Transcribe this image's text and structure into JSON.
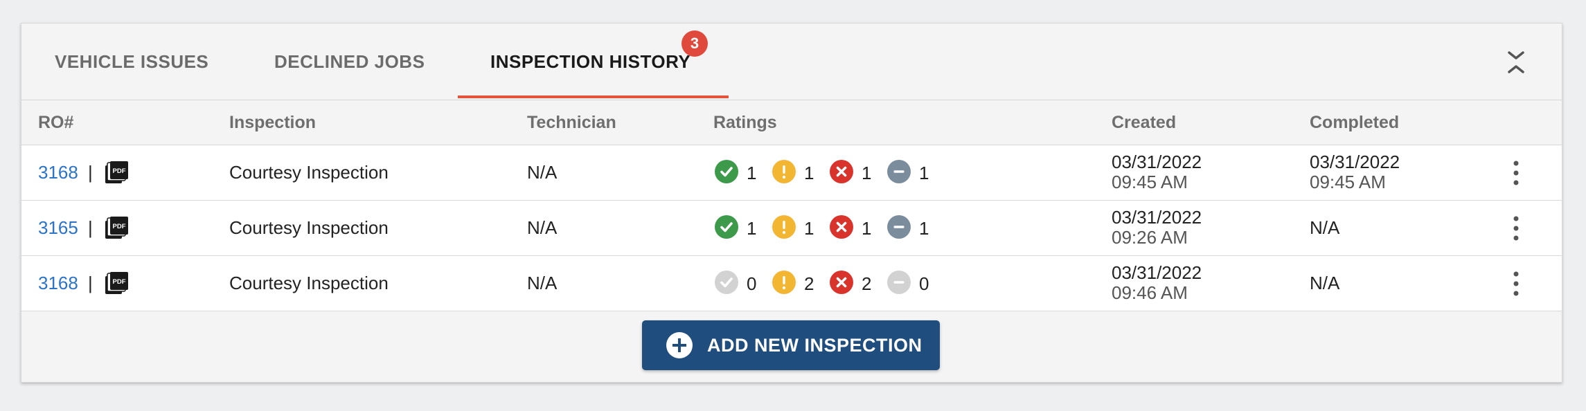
{
  "tabs": [
    {
      "label": "VEHICLE ISSUES",
      "active": false
    },
    {
      "label": "DECLINED JOBS",
      "active": false
    },
    {
      "label": "INSPECTION HISTORY",
      "active": true,
      "badge": "3"
    }
  ],
  "collapse_icon": "collapse-chevrons-icon",
  "columns": {
    "ro": "RO#",
    "inspection": "Inspection",
    "technician": "Technician",
    "ratings": "Ratings",
    "created": "Created",
    "completed": "Completed"
  },
  "rows": [
    {
      "ro": "3168",
      "sep": "|",
      "inspection": "Courtesy Inspection",
      "technician": "N/A",
      "ratings": {
        "good": "1",
        "warning": "1",
        "bad": "1",
        "na": "1"
      },
      "created_date": "03/31/2022",
      "created_time": "09:45 AM",
      "completed_date": "03/31/2022",
      "completed_time": "09:45 AM"
    },
    {
      "ro": "3165",
      "sep": "|",
      "inspection": "Courtesy Inspection",
      "technician": "N/A",
      "ratings": {
        "good": "1",
        "warning": "1",
        "bad": "1",
        "na": "1"
      },
      "created_date": "03/31/2022",
      "created_time": "09:26 AM",
      "completed_date": "N/A",
      "completed_time": ""
    },
    {
      "ro": "3168",
      "sep": "|",
      "inspection": "Courtesy Inspection",
      "technician": "N/A",
      "ratings": {
        "good": "0",
        "warning": "2",
        "bad": "2",
        "na": "0"
      },
      "created_date": "03/31/2022",
      "created_time": "09:46 AM",
      "completed_date": "N/A",
      "completed_time": ""
    }
  ],
  "colors": {
    "good": "#3d9a4a",
    "warning": "#f2b633",
    "bad": "#d9342b",
    "na": "#7b8c9c",
    "inactive": "#d2d2d2",
    "link": "#2a73c9",
    "accent": "#e2553a",
    "button": "#1f4e7e"
  },
  "add_button": {
    "label": "ADD NEW INSPECTION",
    "icon": "plus-circle-icon"
  }
}
